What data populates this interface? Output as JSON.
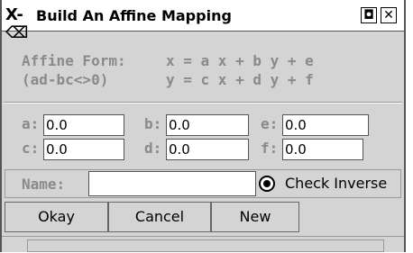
{
  "window": {
    "title": "Build An Affine Mapping"
  },
  "form": {
    "affine_label": "Affine Form:",
    "condition_label": "(ad-bc<>0)",
    "eq_x": "x = a x + b y + e",
    "eq_y": "y = c x + d y + f"
  },
  "fields": {
    "a": {
      "label": "a:",
      "value": "0.0"
    },
    "b": {
      "label": "b:",
      "value": "0.0"
    },
    "e": {
      "label": "e:",
      "value": "0.0"
    },
    "c": {
      "label": "c:",
      "value": "0.0"
    },
    "d": {
      "label": "d:",
      "value": "0.0"
    },
    "f": {
      "label": "f:",
      "value": "0.0"
    }
  },
  "name": {
    "label": "Name:",
    "value": ""
  },
  "check_inverse": {
    "label": "Check Inverse",
    "selected": true
  },
  "buttons": {
    "okay": "Okay",
    "cancel": "Cancel",
    "new": "New"
  }
}
